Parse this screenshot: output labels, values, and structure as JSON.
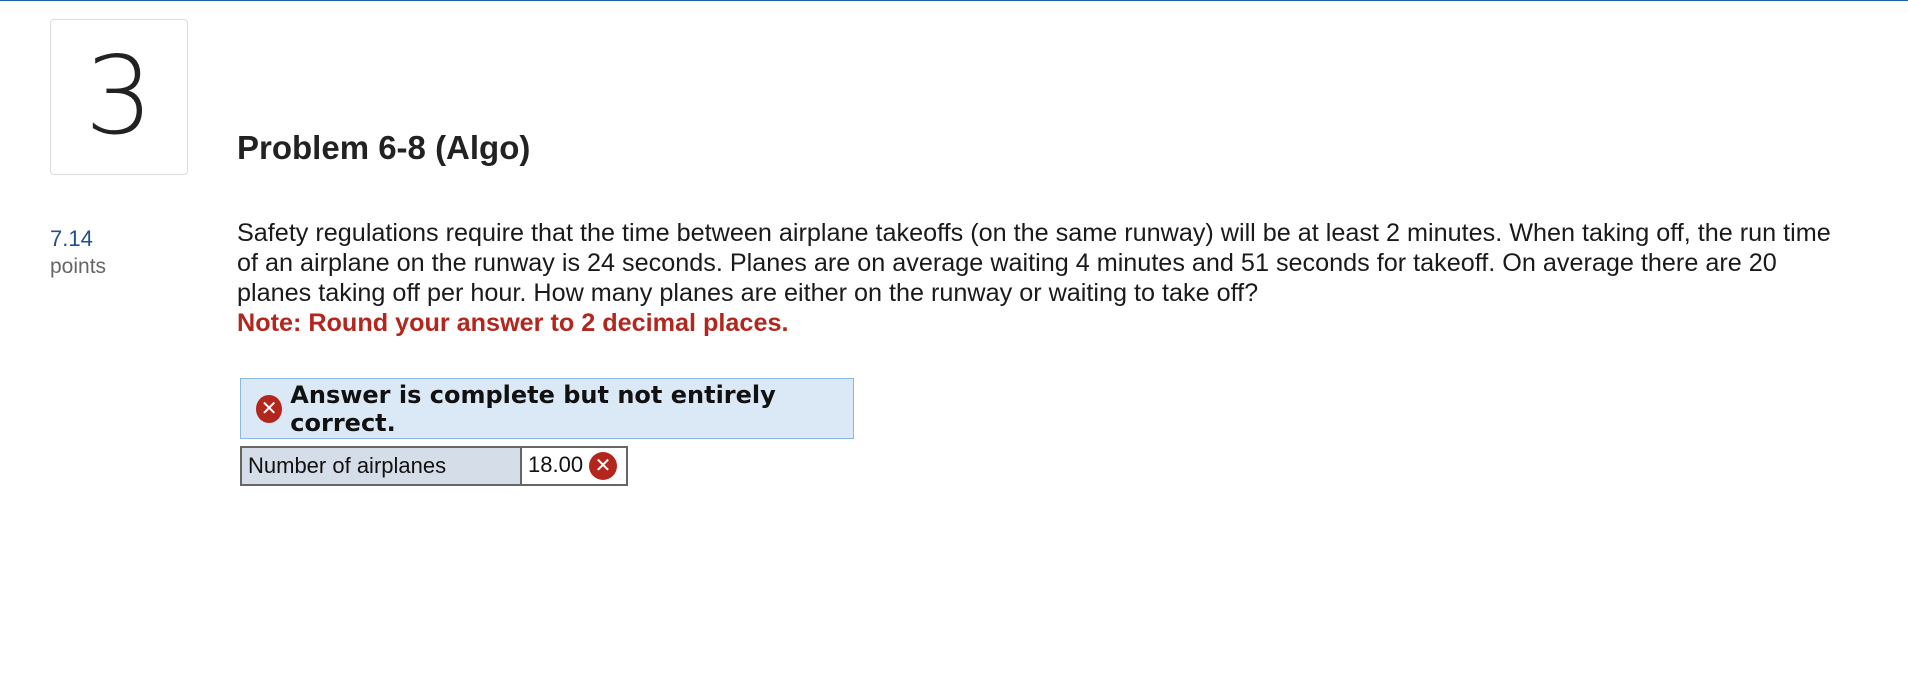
{
  "question_number": "3",
  "title": "Problem 6-8 (Algo)",
  "points": {
    "value": "7.14",
    "label": "points"
  },
  "question": {
    "text": "Safety regulations require that the time between airplane takeoffs (on the same runway) will be at least 2 minutes. When taking off, the run time of an airplane on the runway is 24 seconds. Planes are on average waiting 4 minutes and 51 seconds for takeoff. On average there are 20 planes taking off per hour. How many planes are either on the runway or waiting to take off?",
    "note": "Note: Round your answer to 2 decimal places."
  },
  "feedback": {
    "icon": "x-circle-icon",
    "text": "Answer is complete but not entirely correct.",
    "status_color": "#b3261e"
  },
  "answer_table": {
    "rows": [
      {
        "label": "Number of airplanes",
        "value": "18.00",
        "status_icon": "x-circle-icon"
      }
    ]
  },
  "colors": {
    "accent": "#1f5fa8",
    "error": "#b3261e",
    "banner_bg": "#dbe9f7"
  }
}
